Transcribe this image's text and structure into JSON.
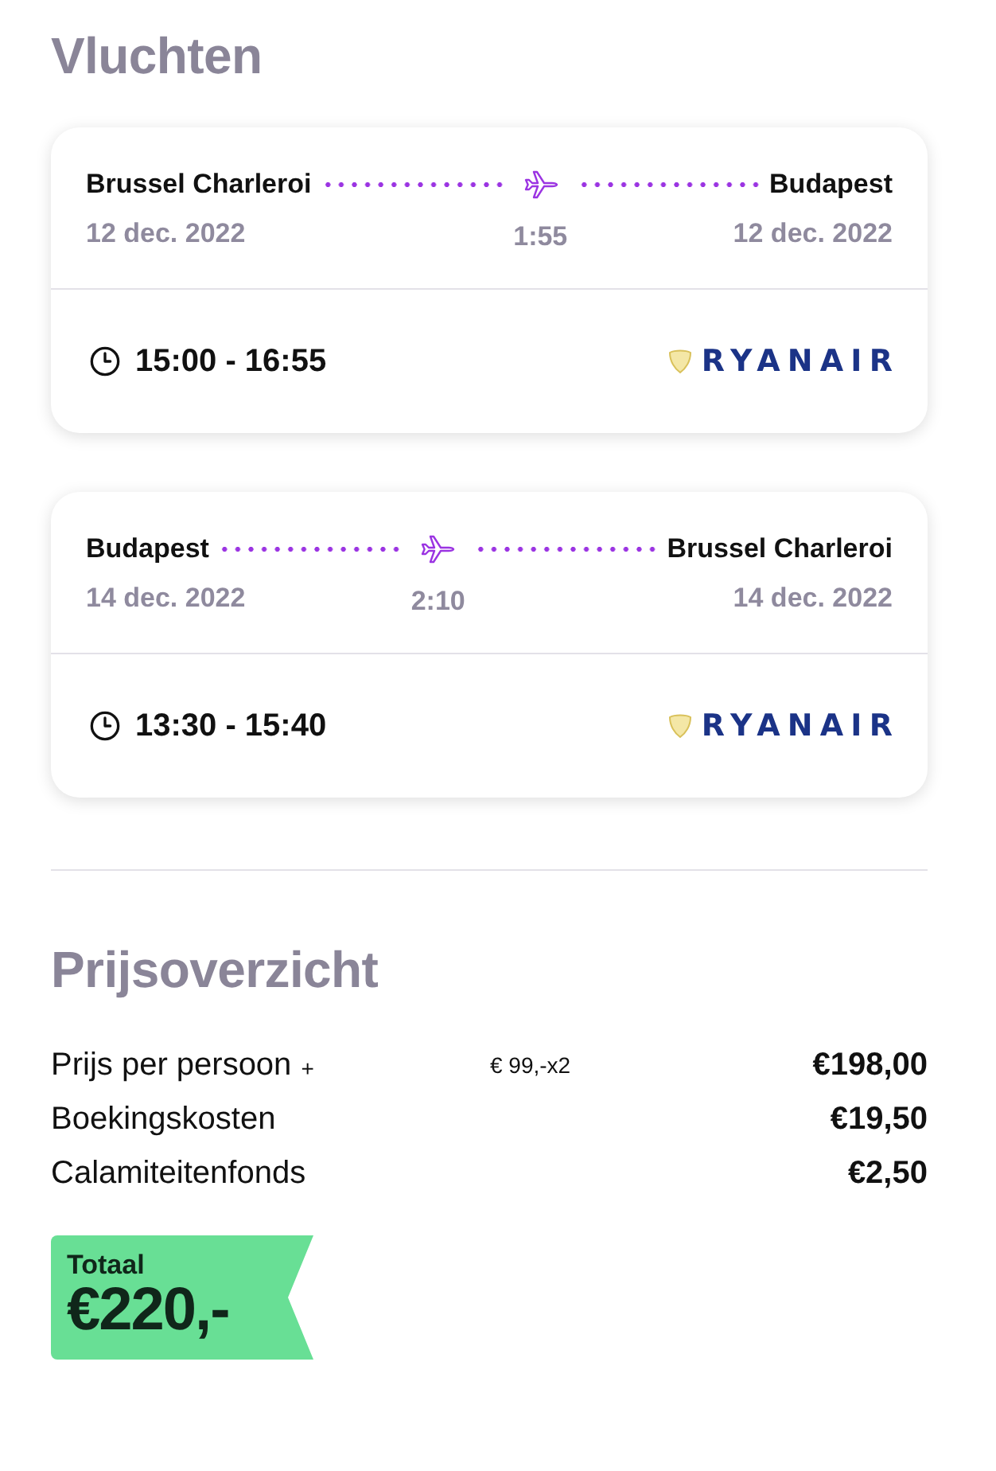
{
  "flights_section": {
    "title": "Vluchten",
    "flights": [
      {
        "origin": "Brussel Charleroi",
        "destination": "Budapest",
        "departure_date": "12 dec. 2022",
        "arrival_date": "12 dec. 2022",
        "duration": "1:55",
        "times": "15:00 - 16:55",
        "airline": "RYANAIR"
      },
      {
        "origin": "Budapest",
        "destination": "Brussel Charleroi",
        "departure_date": "14 dec. 2022",
        "arrival_date": "14 dec. 2022",
        "duration": "2:10",
        "times": "13:30 - 15:40",
        "airline": "RYANAIR"
      }
    ]
  },
  "price_section": {
    "title": "Prijsoverzicht",
    "rows": [
      {
        "label": "Prijs per persoon",
        "label_suffix": "+",
        "detail": "€ 99,-x2",
        "amount": "€198,00"
      },
      {
        "label": "Boekingskosten",
        "amount": "€19,50"
      },
      {
        "label": "Calamiteitenfonds",
        "amount": "€2,50"
      }
    ],
    "total": {
      "label": "Totaal",
      "amount": "€220,-"
    }
  }
}
